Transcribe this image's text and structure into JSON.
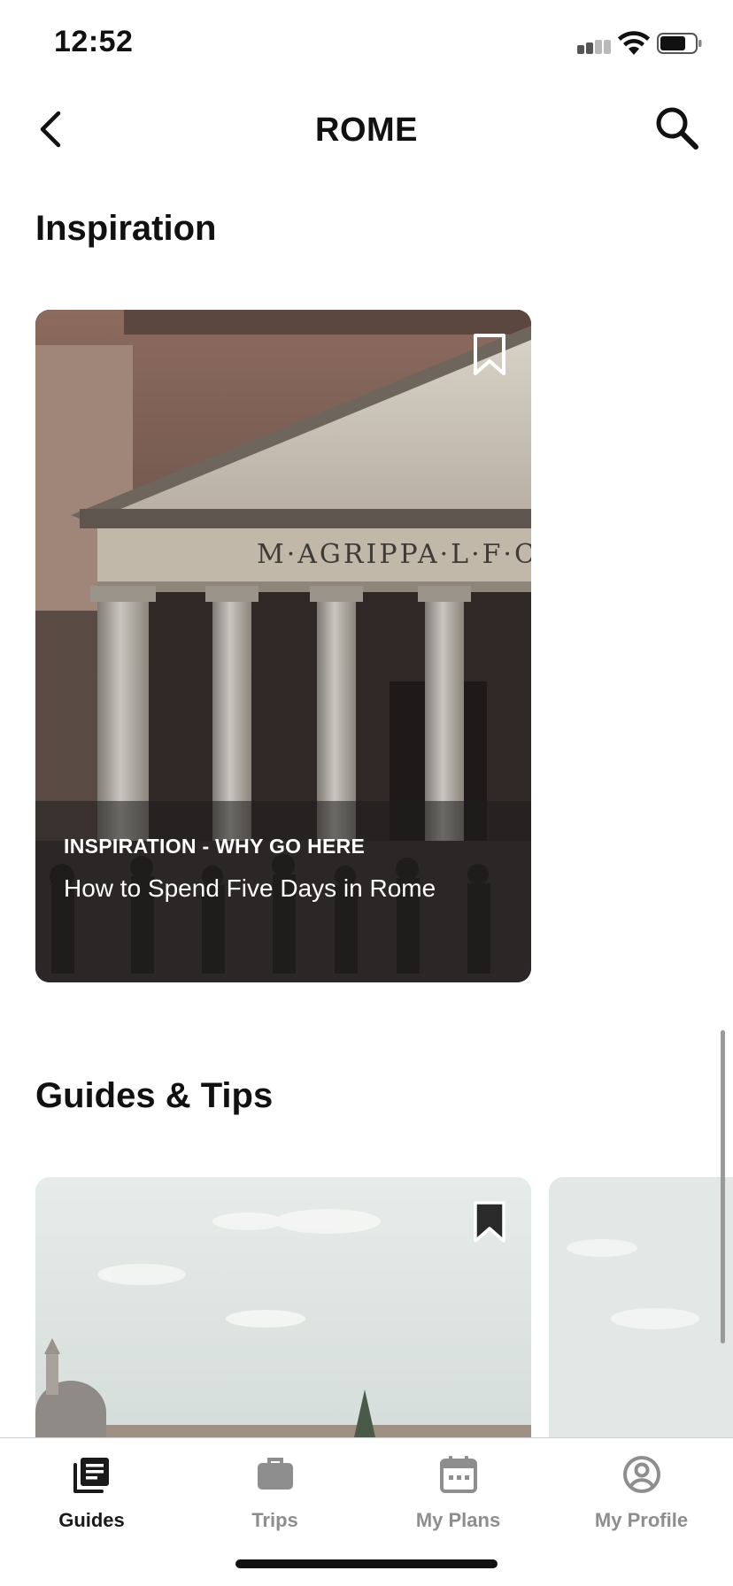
{
  "status_bar": {
    "time": "12:52"
  },
  "header": {
    "title": "ROME"
  },
  "sections": {
    "inspiration": {
      "title": "Inspiration",
      "card": {
        "category": "INSPIRATION - WHY GO HERE",
        "title": "How to Spend Five Days in Rome",
        "bookmark_icon": "bookmark-outline-icon"
      }
    },
    "guides": {
      "title": "Guides & Tips",
      "card": {
        "bookmark_icon": "bookmark-filled-icon"
      }
    }
  },
  "tabbar": {
    "tabs": [
      {
        "label": "Guides",
        "icon": "guides-icon",
        "active": true
      },
      {
        "label": "Trips",
        "icon": "briefcase-icon",
        "active": false
      },
      {
        "label": "My Plans",
        "icon": "calendar-icon",
        "active": false
      },
      {
        "label": "My Profile",
        "icon": "profile-icon",
        "active": false
      }
    ]
  },
  "colors": {
    "active_tab": "#1a1a1a",
    "inactive_tab": "#8e8e8e",
    "text": "#111111"
  }
}
